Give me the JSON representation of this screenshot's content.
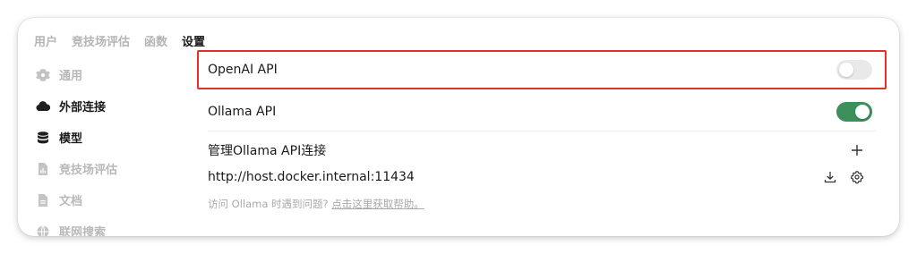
{
  "tabs": [
    {
      "label": "用户",
      "active": false
    },
    {
      "label": "竞技场评估",
      "active": false
    },
    {
      "label": "函数",
      "active": false
    },
    {
      "label": "设置",
      "active": true
    }
  ],
  "sidebar": {
    "items": [
      {
        "label": "通用",
        "icon": "gear-icon"
      },
      {
        "label": "外部连接",
        "icon": "cloud-icon"
      },
      {
        "label": "模型",
        "icon": "database-icon"
      },
      {
        "label": "竞技场评估",
        "icon": "document-chart-icon"
      },
      {
        "label": "文档",
        "icon": "document-icon"
      },
      {
        "label": "联网搜索",
        "icon": "globe-icon"
      }
    ]
  },
  "connections": {
    "openai_label": "OpenAI API",
    "openai_enabled": false,
    "ollama_label": "Ollama API",
    "ollama_enabled": true,
    "manage_label": "管理Ollama API连接",
    "ollama_url": "http://host.docker.internal:11434",
    "help_text": "访问 Ollama 时遇到问题?",
    "help_link": "点击这里获取帮助。"
  },
  "colors": {
    "highlight_border": "#e0322b",
    "toggle_on": "#3d8f5c",
    "toggle_off": "#e9e9e9"
  }
}
